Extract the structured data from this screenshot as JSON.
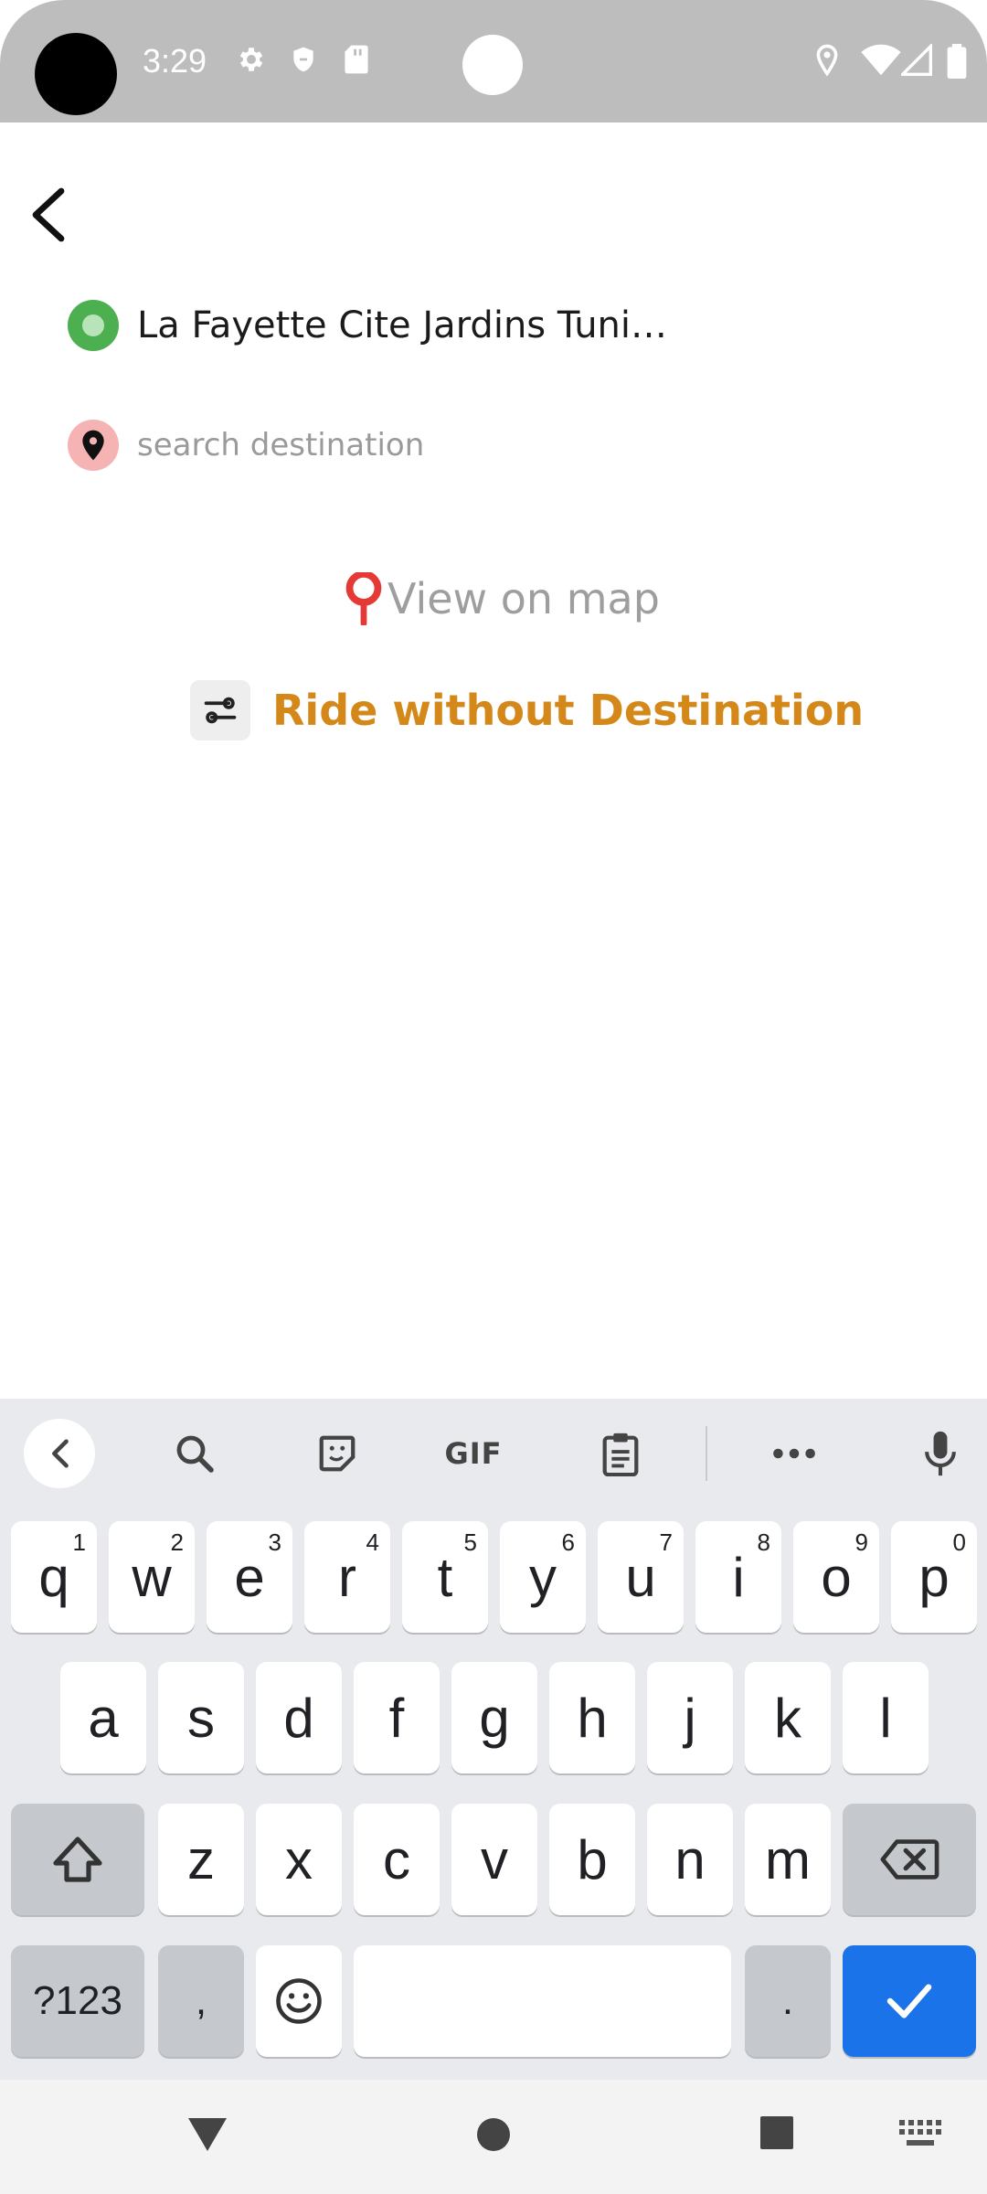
{
  "status_bar": {
    "time": "3:29",
    "icons": [
      "gear-icon",
      "shield-icon",
      "sd-card-icon",
      "location-icon",
      "wifi-icon",
      "signal-icon",
      "battery-icon"
    ]
  },
  "trip": {
    "origin_text": "La Fayette  Cite Jardins Tunis…",
    "destination_placeholder": "search destination",
    "destination_value": ""
  },
  "actions": {
    "view_on_map": "View on map",
    "ride_without_destination": "Ride without Destination"
  },
  "colors": {
    "accent": "#d4881a",
    "origin_green": "#4caf50",
    "destination_pink": "#f6b3b3",
    "map_pin_red": "#e53935",
    "keyboard_blue": "#1a73e8"
  },
  "keyboard": {
    "toolbar": [
      "back-icon",
      "search-icon",
      "sticker-icon",
      "GIF",
      "clipboard-icon",
      "more-icon",
      "mic-icon"
    ],
    "gif_label": "GIF",
    "row1": [
      {
        "k": "q",
        "h": "1"
      },
      {
        "k": "w",
        "h": "2"
      },
      {
        "k": "e",
        "h": "3"
      },
      {
        "k": "r",
        "h": "4"
      },
      {
        "k": "t",
        "h": "5"
      },
      {
        "k": "y",
        "h": "6"
      },
      {
        "k": "u",
        "h": "7"
      },
      {
        "k": "i",
        "h": "8"
      },
      {
        "k": "o",
        "h": "9"
      },
      {
        "k": "p",
        "h": "0"
      }
    ],
    "row2": [
      "a",
      "s",
      "d",
      "f",
      "g",
      "h",
      "j",
      "k",
      "l"
    ],
    "row3": [
      "z",
      "x",
      "c",
      "v",
      "b",
      "n",
      "m"
    ],
    "symbols_label": "?123",
    "comma": ",",
    "period": "."
  },
  "nav_bar": [
    "back-triangle-icon",
    "home-circle-icon",
    "recents-square-icon",
    "keyboard-switch-icon"
  ]
}
